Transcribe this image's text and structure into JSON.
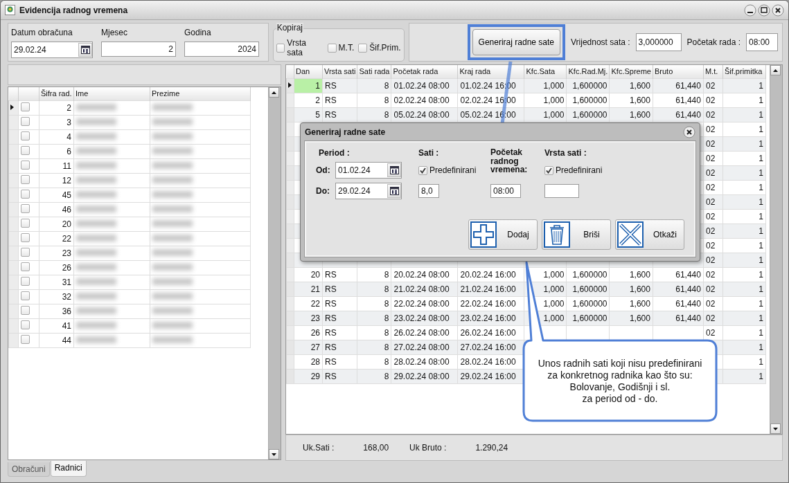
{
  "window": {
    "title": "Evidencija radnog vremena"
  },
  "header": {
    "fields": [
      {
        "label": "Datum obračuna",
        "value": "29.02.24",
        "kind": "date"
      },
      {
        "label": "Mjesec",
        "value": "2",
        "kind": "number"
      },
      {
        "label": "Godina",
        "value": "2024",
        "kind": "number"
      }
    ],
    "copy_group": {
      "title": "Kopiraj",
      "options": [
        {
          "label": "Vrsta sata",
          "checked": false
        },
        {
          "label": "M.T.",
          "checked": false
        },
        {
          "label": "Šif.Prim.",
          "checked": false
        }
      ]
    },
    "generate_button": {
      "label": "Generiraj radne sate",
      "highlighted": true
    },
    "hour_value": {
      "label": "Vrijednost sata :",
      "value": "3,000000"
    },
    "work_start": {
      "label": "Početak rada :",
      "value": "08:00"
    }
  },
  "employees": {
    "columns": [
      "Šifra rad.",
      "Ime",
      "Prezime"
    ],
    "rows": [
      {
        "code": "2",
        "checked": false,
        "selected": true
      },
      {
        "code": "3",
        "checked": false,
        "selected": false
      },
      {
        "code": "4",
        "checked": false,
        "selected": false
      },
      {
        "code": "6",
        "checked": false,
        "selected": false
      },
      {
        "code": "11",
        "checked": false,
        "selected": false
      },
      {
        "code": "12",
        "checked": false,
        "selected": false
      },
      {
        "code": "45",
        "checked": false,
        "selected": false
      },
      {
        "code": "46",
        "checked": false,
        "selected": false
      },
      {
        "code": "20",
        "checked": false,
        "selected": false
      },
      {
        "code": "22",
        "checked": false,
        "selected": false
      },
      {
        "code": "23",
        "checked": false,
        "selected": false
      },
      {
        "code": "26",
        "checked": false,
        "selected": false
      },
      {
        "code": "31",
        "checked": false,
        "selected": false
      },
      {
        "code": "32",
        "checked": false,
        "selected": false
      },
      {
        "code": "36",
        "checked": false,
        "selected": false
      },
      {
        "code": "41",
        "checked": false,
        "selected": false
      },
      {
        "code": "44",
        "checked": false,
        "selected": false
      }
    ]
  },
  "tabs": [
    {
      "label": "Obračuni",
      "selected": false
    },
    {
      "label": "Radnici",
      "selected": true
    }
  ],
  "hours": {
    "columns": [
      "Dan",
      "Vrsta sati",
      "Sati rada",
      "Početak rada",
      "Kraj rada",
      "Kfc.Sata",
      "Kfc.Rad.Mj.",
      "Kfc.Spreme",
      "Bruto",
      "M.t.",
      "Šif.primitka"
    ],
    "rows": [
      {
        "selected": true,
        "cells": [
          "1",
          "RS",
          "8",
          "01.02.24 08:00",
          "01.02.24 16:00",
          "1,000",
          "1,600000",
          "1,600",
          "61,440",
          "02",
          "1"
        ]
      },
      {
        "selected": false,
        "cells": [
          "2",
          "RS",
          "8",
          "02.02.24 08:00",
          "02.02.24 16:00",
          "1,000",
          "1,600000",
          "1,600",
          "61,440",
          "02",
          "1"
        ]
      },
      {
        "selected": false,
        "cells": [
          "5",
          "RS",
          "8",
          "05.02.24 08:00",
          "05.02.24 16:00",
          "1,000",
          "1,600000",
          "1,600",
          "61,440",
          "02",
          "1"
        ]
      },
      {
        "selected": false,
        "cells": [
          null,
          null,
          null,
          null,
          null,
          null,
          null,
          null,
          null,
          "02",
          "1"
        ]
      },
      {
        "selected": false,
        "cells": [
          null,
          null,
          null,
          null,
          null,
          null,
          null,
          null,
          null,
          "02",
          "1"
        ]
      },
      {
        "selected": false,
        "cells": [
          null,
          null,
          null,
          null,
          null,
          null,
          null,
          null,
          null,
          "02",
          "1"
        ]
      },
      {
        "selected": false,
        "cells": [
          null,
          null,
          null,
          null,
          null,
          null,
          null,
          null,
          null,
          "02",
          "1"
        ]
      },
      {
        "selected": false,
        "cells": [
          null,
          null,
          null,
          null,
          null,
          null,
          null,
          null,
          null,
          "02",
          "1"
        ]
      },
      {
        "selected": false,
        "cells": [
          null,
          null,
          null,
          null,
          null,
          null,
          null,
          null,
          null,
          "02",
          "1"
        ]
      },
      {
        "selected": false,
        "cells": [
          null,
          null,
          null,
          null,
          null,
          null,
          null,
          null,
          null,
          "02",
          "1"
        ]
      },
      {
        "selected": false,
        "cells": [
          null,
          null,
          null,
          null,
          null,
          null,
          null,
          null,
          null,
          "02",
          "1"
        ]
      },
      {
        "selected": false,
        "cells": [
          null,
          null,
          null,
          null,
          null,
          null,
          null,
          null,
          null,
          "02",
          "1"
        ]
      },
      {
        "selected": false,
        "cells": [
          null,
          null,
          null,
          null,
          null,
          null,
          null,
          null,
          null,
          "02",
          "1"
        ]
      },
      {
        "selected": false,
        "cells": [
          "20",
          "RS",
          "8",
          "20.02.24 08:00",
          "20.02.24 16:00",
          "1,000",
          "1,600000",
          "1,600",
          "61,440",
          "02",
          "1"
        ]
      },
      {
        "selected": false,
        "cells": [
          "21",
          "RS",
          "8",
          "21.02.24 08:00",
          "21.02.24 16:00",
          "1,000",
          "1,600000",
          "1,600",
          "61,440",
          "02",
          "1"
        ]
      },
      {
        "selected": false,
        "cells": [
          "22",
          "RS",
          "8",
          "22.02.24 08:00",
          "22.02.24 16:00",
          "1,000",
          "1,600000",
          "1,600",
          "61,440",
          "02",
          "1"
        ]
      },
      {
        "selected": false,
        "cells": [
          "23",
          "RS",
          "8",
          "23.02.24 08:00",
          "23.02.24 16:00",
          "1,000",
          "1,600000",
          "1,600",
          "61,440",
          "02",
          "1"
        ]
      },
      {
        "selected": false,
        "cells": [
          "26",
          "RS",
          "8",
          "26.02.24 08:00",
          "26.02.24 16:00",
          null,
          null,
          null,
          null,
          "02",
          "1"
        ]
      },
      {
        "selected": false,
        "cells": [
          "27",
          "RS",
          "8",
          "27.02.24 08:00",
          "27.02.24 16:00",
          null,
          null,
          null,
          null,
          null,
          "1"
        ]
      },
      {
        "selected": false,
        "cells": [
          "28",
          "RS",
          "8",
          "28.02.24 08:00",
          "28.02.24 16:00",
          null,
          null,
          null,
          null,
          null,
          "1"
        ]
      },
      {
        "selected": false,
        "cells": [
          "29",
          "RS",
          "8",
          "29.02.24 08:00",
          "29.02.24 16:00",
          null,
          null,
          null,
          null,
          null,
          "1"
        ]
      }
    ],
    "totals": [
      {
        "label": "Uk.Sati :",
        "value": "168,00"
      },
      {
        "label": "Uk Bruto :",
        "value": "1.290,24"
      }
    ]
  },
  "dialog": {
    "title": "Generiraj radne sate",
    "period_label": "Period :",
    "from_label": "Od:",
    "from_value": "01.02.24",
    "to_label": "Do:",
    "to_value": "29.02.24",
    "hours_label": "Sati :",
    "hours_predefined": {
      "label": "Predefinirani",
      "checked": true
    },
    "hours_value": "8,0",
    "start_label": "Početak radnog vremena:",
    "start_value": "08:00",
    "type_label": "Vrsta sati :",
    "type_predefined": {
      "label": "Predefinirani",
      "checked": true
    },
    "buttons": [
      {
        "label": "Dodaj",
        "kind": "add"
      },
      {
        "label": "Briši",
        "kind": "delete"
      },
      {
        "label": "Otkaži",
        "kind": "cancel"
      }
    ]
  },
  "callout": {
    "text": "Unos radnih sati koji nisu predefinirani\nza konkretnog radnika kao što su:\nBolovanje, Godišnji i sl.\nza period od - do."
  }
}
